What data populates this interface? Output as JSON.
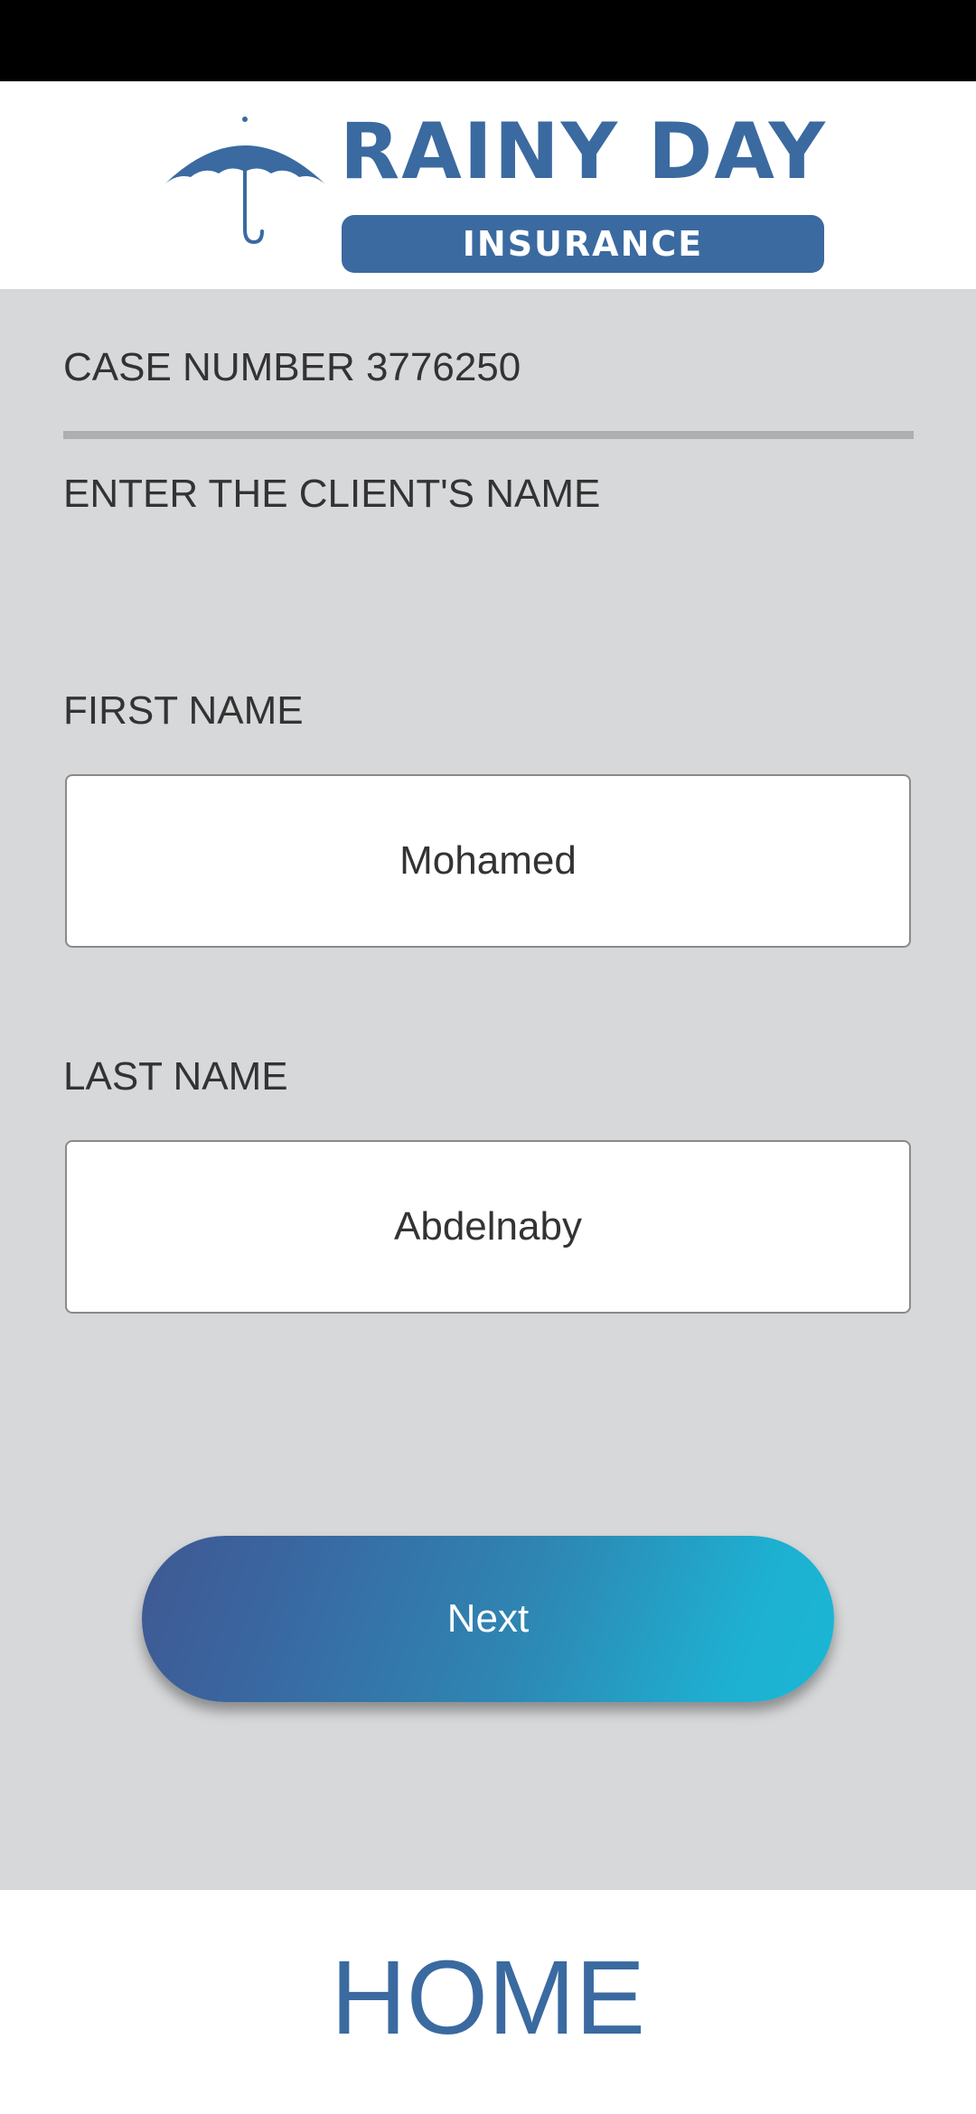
{
  "header": {
    "logo_title": "RAINY DAY",
    "logo_subtitle": "INSURANCE",
    "brand_color": "#3a6aa0"
  },
  "form": {
    "case_number": "CASE NUMBER 3776250",
    "instruction": "ENTER THE CLIENT'S NAME",
    "first_name": {
      "label": "FIRST NAME",
      "value": "Mohamed"
    },
    "last_name": {
      "label": "LAST NAME",
      "value": "Abdelnaby"
    },
    "next_label": "Next"
  },
  "footer": {
    "home_label": "HOME"
  },
  "colors": {
    "background": "#d7d8da",
    "status_bar": "#000000",
    "gradient_start": "#3f5892",
    "gradient_end": "#1ab7d4"
  }
}
